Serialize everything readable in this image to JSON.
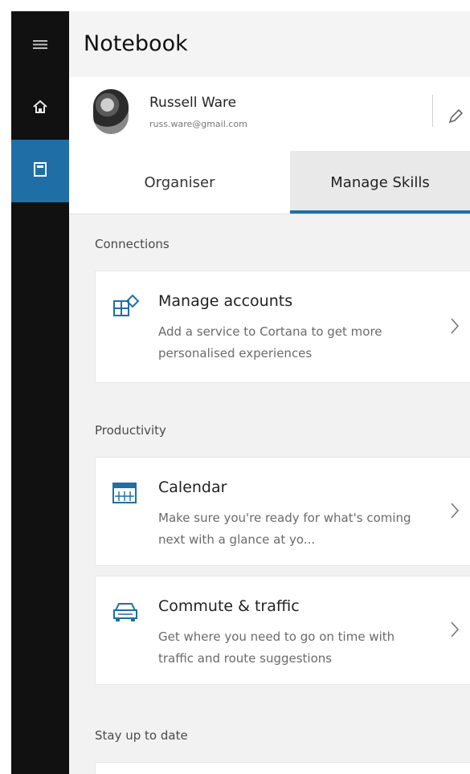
{
  "app": {
    "title": "Notebook"
  },
  "profile": {
    "name": "Russell Ware",
    "email": "russ.ware@gmail.com"
  },
  "tabs": [
    {
      "label": "Organiser",
      "selected": false
    },
    {
      "label": "Manage Skills",
      "selected": true
    }
  ],
  "sections": {
    "connections": "Connections",
    "productivity": "Productivity",
    "stay_up_to_date": "Stay up to date"
  },
  "cards": {
    "manage_accounts": {
      "title": "Manage accounts",
      "description": "Add a service to Cortana to get more personalised experiences",
      "icon": "manage-accounts-icon"
    },
    "calendar": {
      "title": "Calendar",
      "description": "Make sure you're ready for what's coming next with a glance at yo...",
      "icon": "calendar-icon"
    },
    "commute": {
      "title": "Commute & traffic",
      "description": "Get where you need to go on time with traffic and route suggestions",
      "icon": "car-icon"
    }
  },
  "colors": {
    "accent": "#1f6fa6",
    "rail": "#111111",
    "content_bg": "#f2f2f2"
  },
  "icons": {
    "menu": "hamburger-menu-icon",
    "home": "home-icon",
    "notebook": "notebook-icon",
    "edit": "edit-pencil-icon",
    "chevron": "chevron-right-icon"
  }
}
